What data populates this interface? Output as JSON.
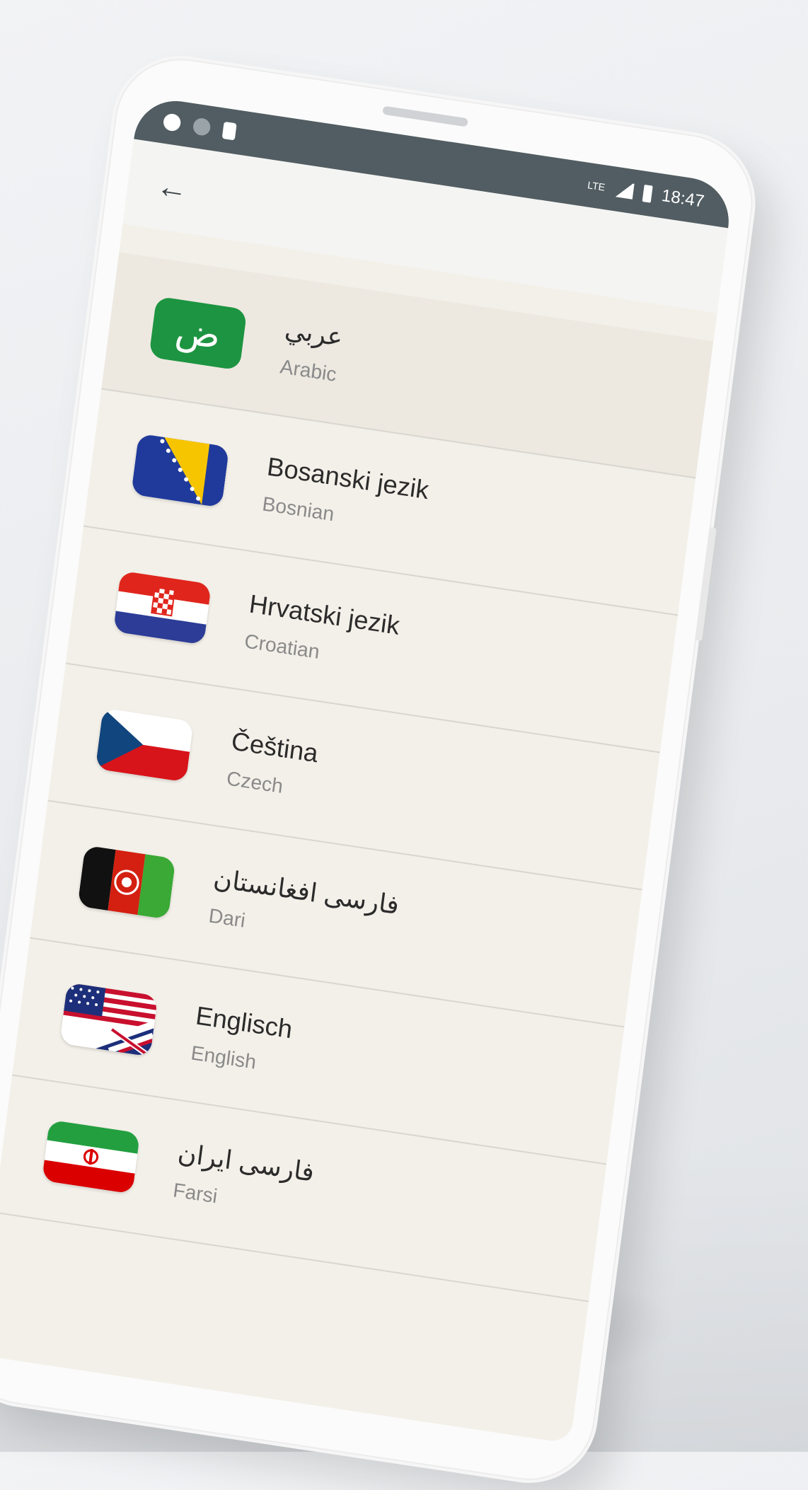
{
  "status_bar": {
    "time": "18:47",
    "network_label": "LTE",
    "left_icons": [
      "notification-icon",
      "notification-icon",
      "sd-card-icon"
    ]
  },
  "app_bar": {
    "back_icon": "arrow-left-icon"
  },
  "languages": [
    {
      "native": "عربي",
      "english": "Arabic",
      "flag": "arabic-letter-tile",
      "tile_text": "ض"
    },
    {
      "native": "Bosanski jezik",
      "english": "Bosnian",
      "flag": "bosnia-flag"
    },
    {
      "native": "Hrvatski jezik",
      "english": "Croatian",
      "flag": "croatia-flag"
    },
    {
      "native": "Čeština",
      "english": "Czech",
      "flag": "czech-flag"
    },
    {
      "native": "فارسی افغانستان",
      "english": "Dari",
      "flag": "afghanistan-flag"
    },
    {
      "native": "Englisch",
      "english": "English",
      "flag": "us-uk-flag"
    },
    {
      "native": "فارسی ایران",
      "english": "Farsi",
      "flag": "iran-flag"
    }
  ],
  "colors": {
    "status_bar": "#515d62",
    "screen_bg": "#f3f0e9",
    "arabic_tile": "#1d9441"
  }
}
